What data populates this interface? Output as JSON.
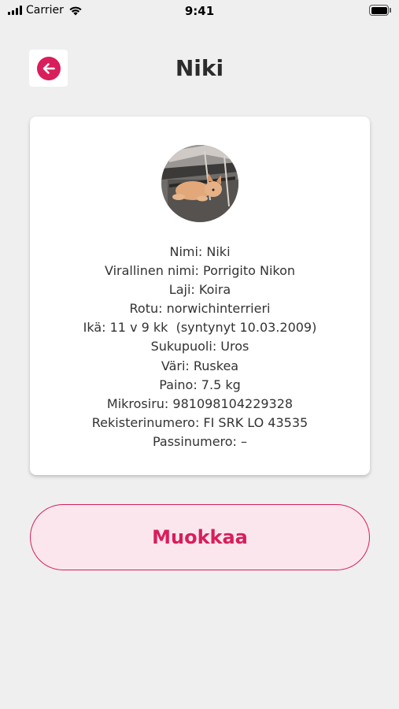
{
  "status_bar": {
    "carrier": "Carrier",
    "time": "9:41"
  },
  "header": {
    "title": "Niki",
    "back_icon": "arrow-left-circle-icon"
  },
  "profile": {
    "photo": "dog-photo",
    "fields": [
      "Nimi: Niki",
      "Virallinen nimi: Porrigito Nikon",
      "Laji: Koira",
      "Rotu: norwichinterrieri",
      "Ikä: 11 v 9 kk  (syntynyt 10.03.2009)",
      "Sukupuoli: Uros",
      "Väri: Ruskea",
      "Paino: 7.5 kg",
      "Mikrosiru: 981098104229328",
      "Rekisterinumero: FI SRK LO 43535",
      "Passinumero: –"
    ]
  },
  "actions": {
    "edit_label": "Muokkaa"
  },
  "colors": {
    "accent": "#d81e5b",
    "accent_bg": "#fce6ee",
    "background": "#efefef"
  }
}
